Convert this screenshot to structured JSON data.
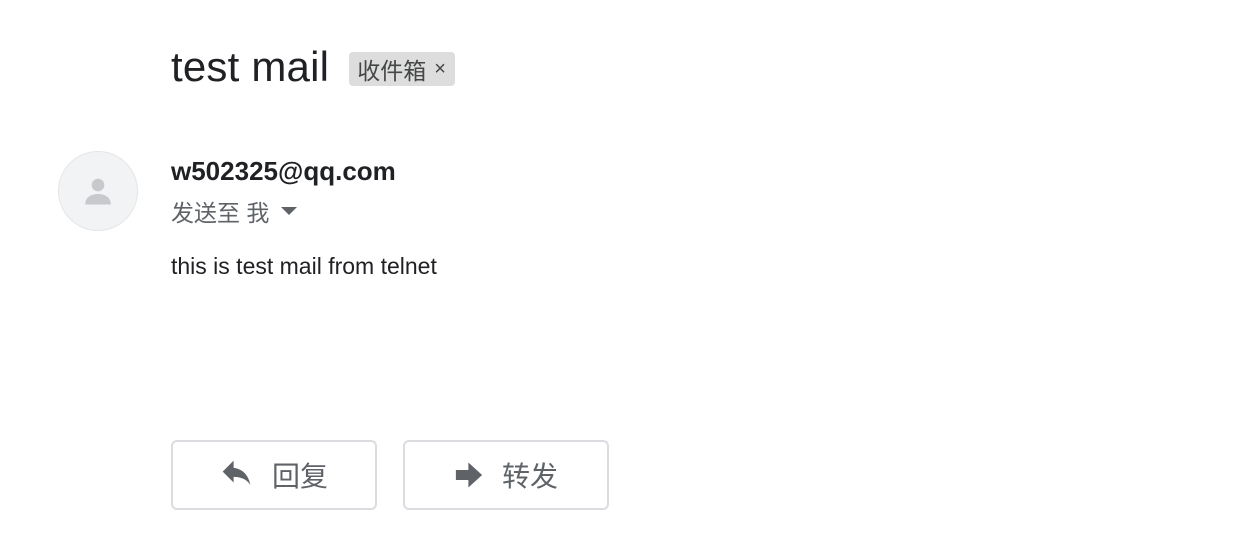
{
  "subject": "test mail",
  "label": {
    "text": "收件箱",
    "close_glyph": "×"
  },
  "message": {
    "avatar_icon": "person-icon",
    "sender": "w502325@qq.com",
    "recipient_text": "发送至 我",
    "body": "this is test mail from telnet"
  },
  "actions": {
    "reply_label": "回复",
    "reply_icon": "reply-icon",
    "forward_label": "转发",
    "forward_icon": "forward-icon"
  },
  "colors": {
    "label_chip_bg": "#dddddd",
    "secondary_text": "#5f6368",
    "button_border": "#dadce0"
  }
}
